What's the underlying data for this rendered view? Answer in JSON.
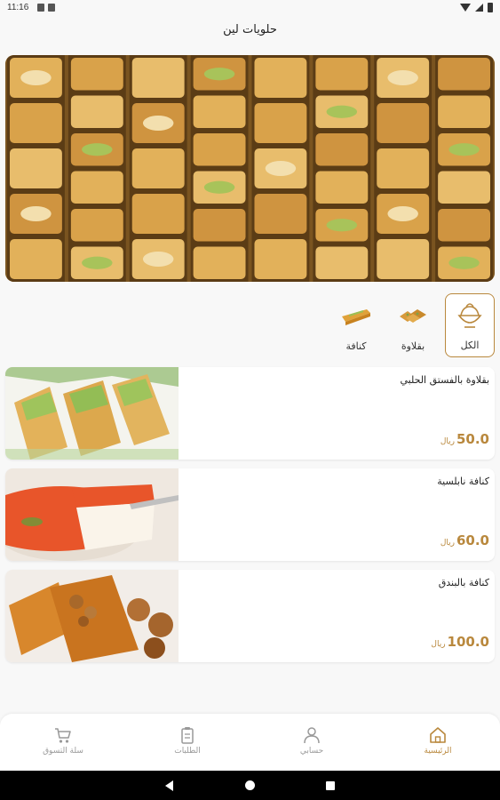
{
  "status_bar": {
    "time": "11:16"
  },
  "header": {
    "title": "حلويات لين"
  },
  "categories": [
    {
      "label": "الكل",
      "icon": "bowl-icon",
      "selected": true
    },
    {
      "label": "بقلاوة",
      "icon": "baklava-icon",
      "selected": false
    },
    {
      "label": "كنافة",
      "icon": "kunafa-icon",
      "selected": false
    }
  ],
  "products": [
    {
      "name": "بقلاوة بالفستق الحلبي",
      "price": "50.0",
      "currency": "ريال"
    },
    {
      "name": "كنافة نابلسية",
      "price": "60.0",
      "currency": "ريال"
    },
    {
      "name": "كنافة بالبندق",
      "price": "100.0",
      "currency": "ريال"
    }
  ],
  "bottom_nav": {
    "home": "الرئيسية",
    "account": "حسابي",
    "orders": "الطلبات",
    "cart": "سلة التسوق"
  },
  "colors": {
    "accent": "#b9883d",
    "inactive": "#999999"
  }
}
